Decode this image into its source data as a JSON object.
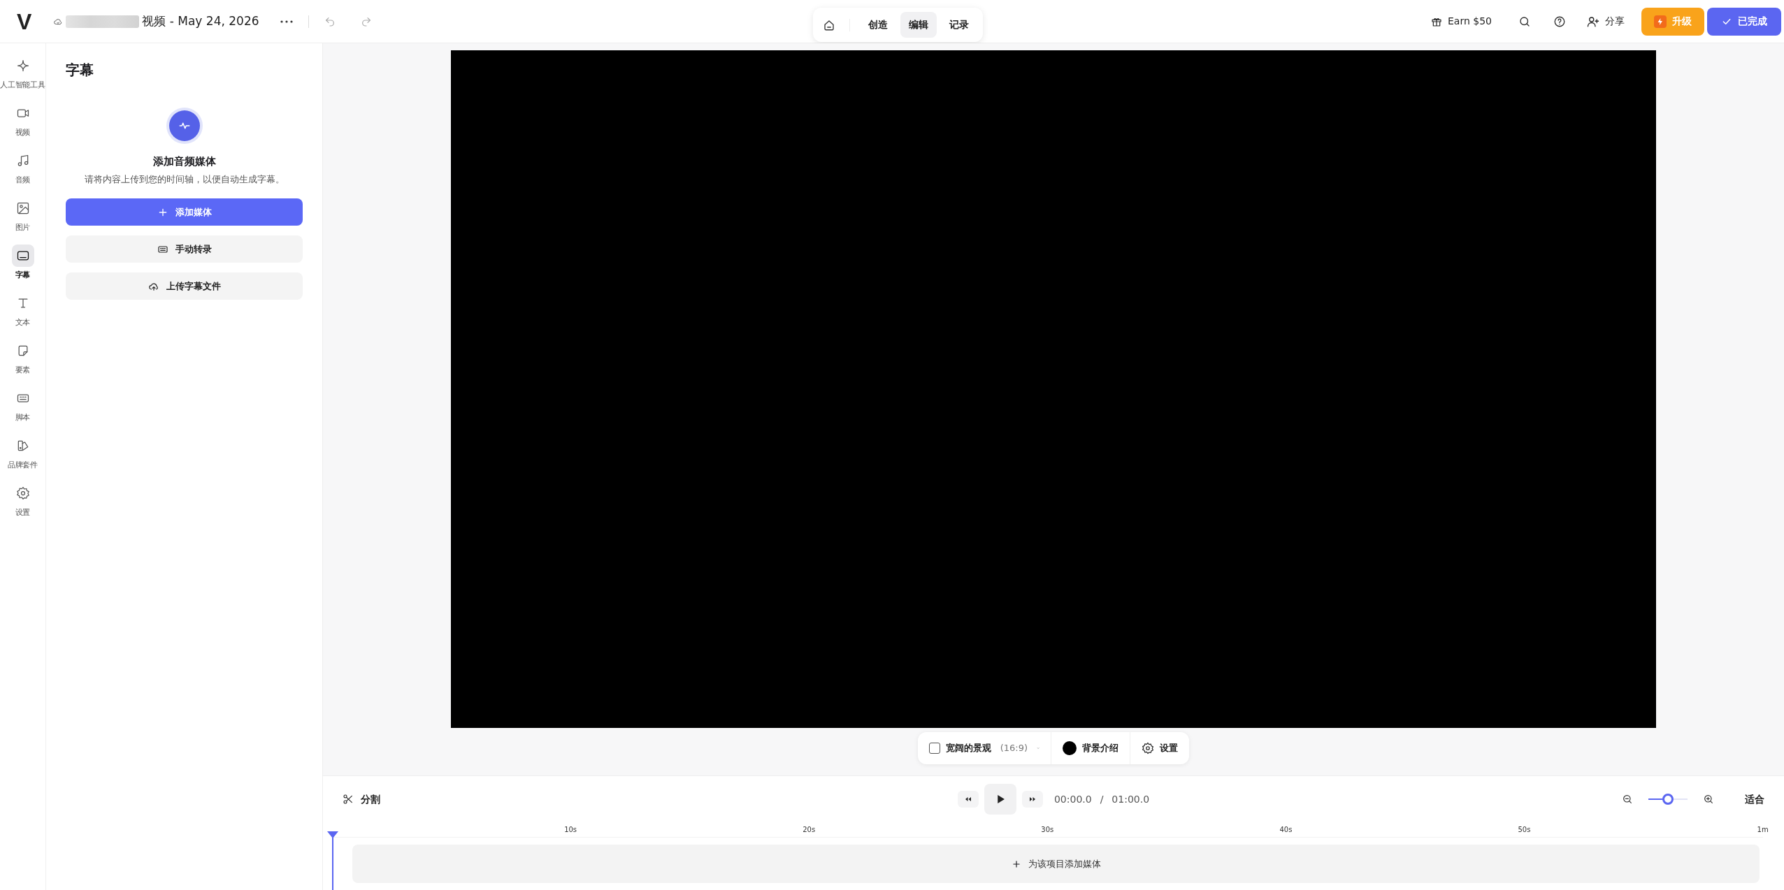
{
  "header": {
    "logo": "V",
    "project_title": "视频 - May 24, 2026",
    "mode_tabs": [
      {
        "label": "创造",
        "selected": false
      },
      {
        "label": "编辑",
        "selected": true
      },
      {
        "label": "记录",
        "selected": false
      }
    ],
    "earn": "Earn $50",
    "share": "分享",
    "upgrade": "升级",
    "done": "已完成"
  },
  "rail": [
    {
      "label": "人工智能工具",
      "kind": "sparkle",
      "selected": false
    },
    {
      "label": "视频",
      "kind": "video",
      "selected": false
    },
    {
      "label": "音频",
      "kind": "music",
      "selected": false
    },
    {
      "label": "图片",
      "kind": "image",
      "selected": false
    },
    {
      "label": "字幕",
      "kind": "subtitle",
      "selected": true
    },
    {
      "label": "文本",
      "kind": "text",
      "selected": false
    },
    {
      "label": "要素",
      "kind": "sticker",
      "selected": false
    },
    {
      "label": "脚本",
      "kind": "script",
      "selected": false
    },
    {
      "label": "品牌套件",
      "kind": "brand",
      "selected": false
    },
    {
      "label": "设置",
      "kind": "settings",
      "selected": false
    }
  ],
  "panel": {
    "title": "字幕",
    "heading": "添加音频媒体",
    "description": "请将内容上传到您的时间轴，以便自动生成字幕。",
    "actions": [
      {
        "label": "添加媒体",
        "kind": "primary"
      },
      {
        "label": "手动转录",
        "kind": "transcribe"
      },
      {
        "label": "上传字幕文件",
        "kind": "upload"
      }
    ]
  },
  "canvas_toolbar": {
    "aspect": {
      "label": "宽阔的景观",
      "ratio": "(16:9)",
      "checked": false
    },
    "background": {
      "label": "背景介绍",
      "color": "#000000"
    },
    "settings": "设置"
  },
  "timeline": {
    "split": "分割",
    "current_time": "00:00.0",
    "separator": "/",
    "duration": "01:00.0",
    "zoom_slider": {
      "level": 0.5
    },
    "fit": "适合",
    "ruler": [
      "10s",
      "20s",
      "30s",
      "40s",
      "50s",
      "1m"
    ],
    "add_media": "为该项目添加媒体"
  }
}
